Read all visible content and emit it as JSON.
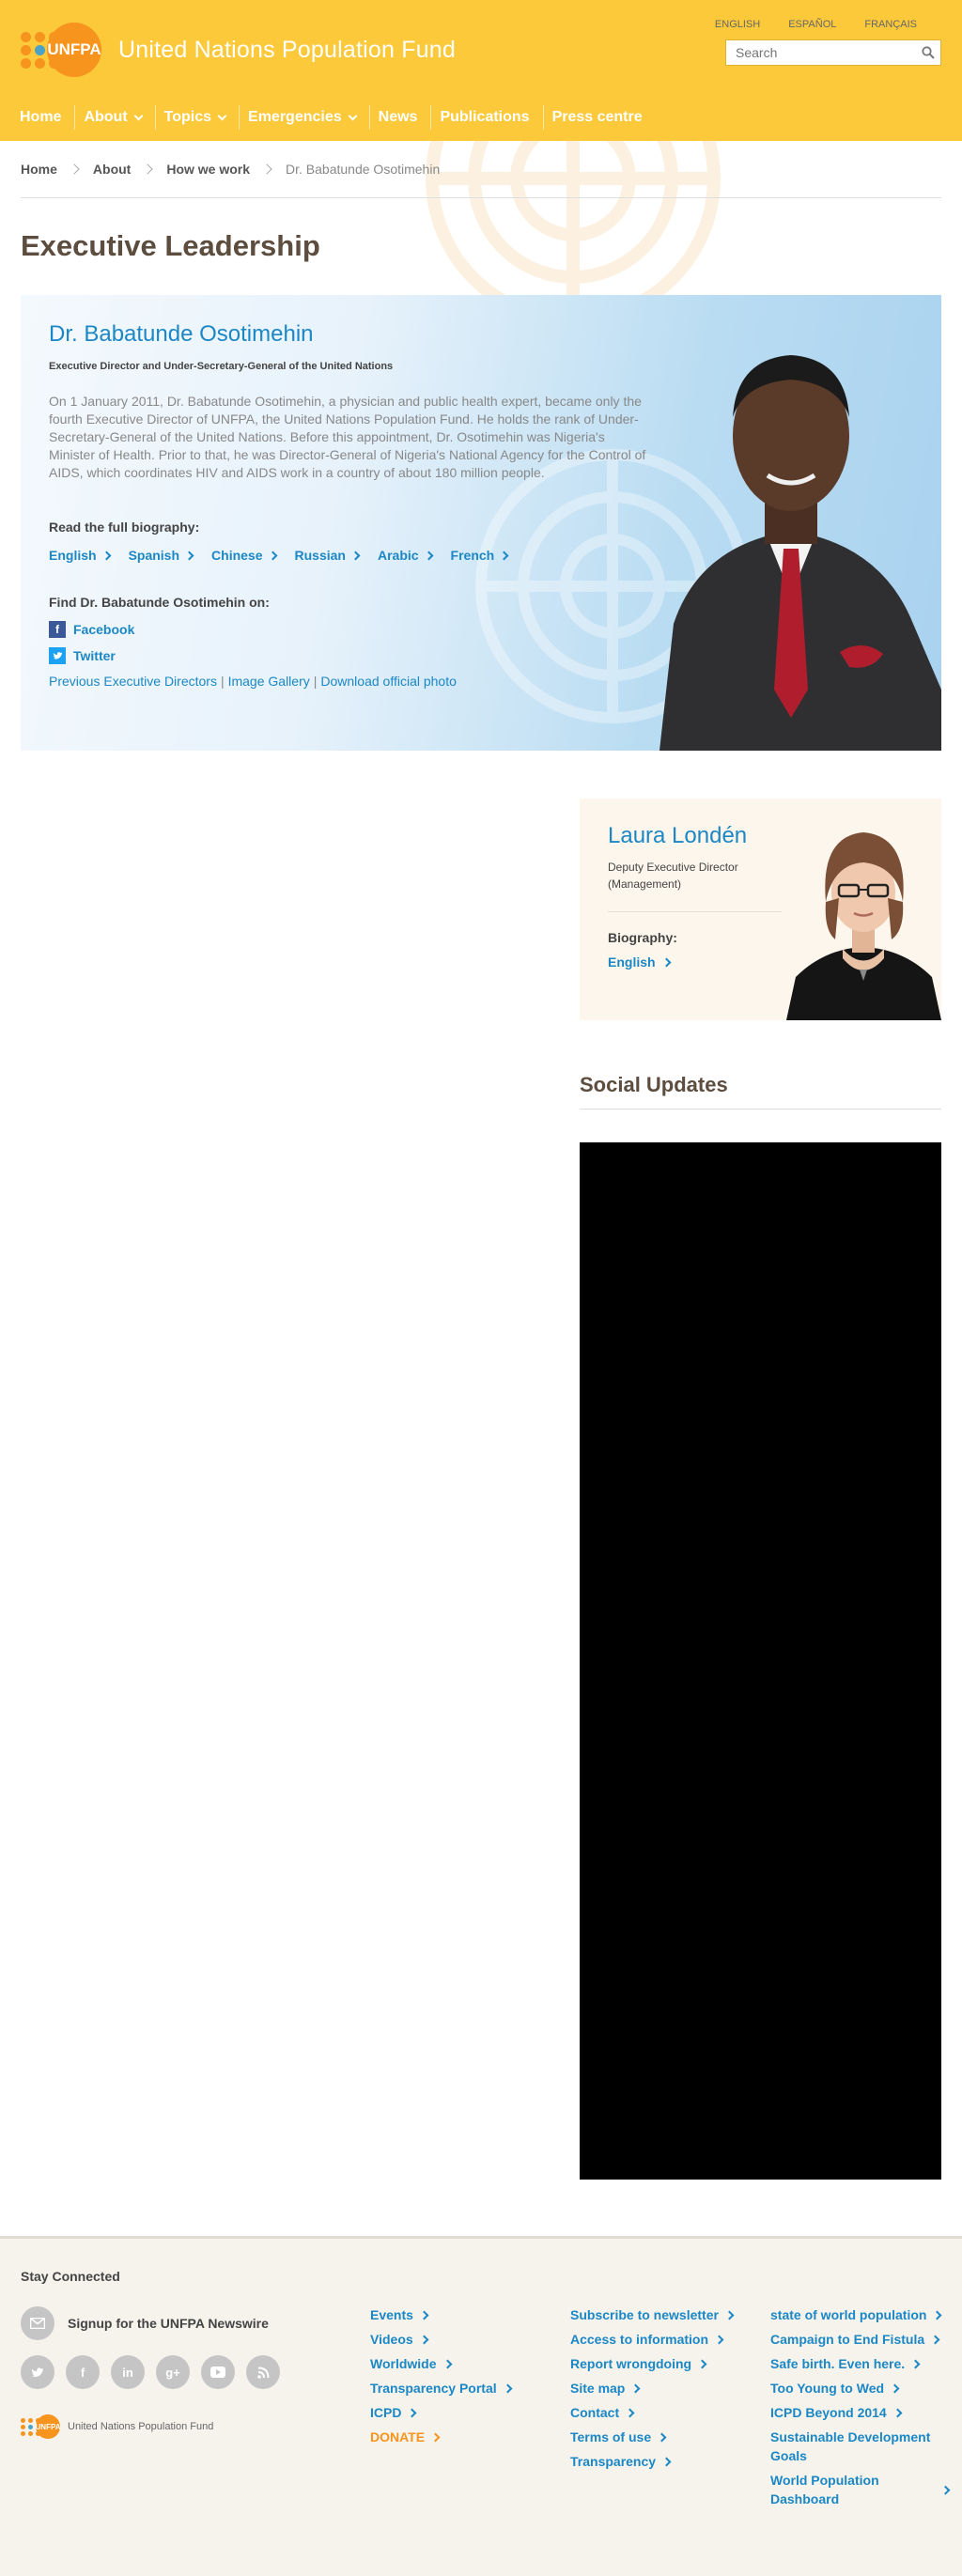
{
  "header": {
    "logo_text": "UNFPA",
    "org_name": "United Nations Population Fund",
    "languages": [
      "ENGLISH",
      "ESPAÑOL",
      "FRANÇAIS"
    ],
    "search_placeholder": "Search",
    "colors": {
      "header_bg": "#fbc93a",
      "accent_orange": "#f7941e",
      "link_blue": "#1b87c5"
    }
  },
  "nav": {
    "items": [
      {
        "label": "Home",
        "dropdown": false
      },
      {
        "label": "About",
        "dropdown": true
      },
      {
        "label": "Topics",
        "dropdown": true
      },
      {
        "label": "Emergencies",
        "dropdown": true
      },
      {
        "label": "News",
        "dropdown": false
      },
      {
        "label": "Publications",
        "dropdown": false
      },
      {
        "label": "Press centre",
        "dropdown": false
      }
    ]
  },
  "breadcrumb": {
    "items": [
      "Home",
      "About",
      "How we work"
    ],
    "current": "Dr. Babatunde Osotimehin"
  },
  "page_title": "Executive Leadership",
  "director": {
    "name": "Dr. Babatunde Osotimehin",
    "role": "Executive Director and Under-Secretary-General of the United Nations",
    "bio": "On 1 January 2011, Dr. Babatunde Osotimehin, a physician and public health expert, became only the fourth Executive Director of UNFPA, the United Nations Population Fund. He holds the rank of Under-Secretary-General of the United Nations. Before this appointment, Dr. Osotimehin was Nigeria's Minister of Health. Prior to that, he was Director-General of Nigeria's National Agency for the Control of AIDS, which coordinates HIV and AIDS work in a country of about 180 million people.",
    "biography_heading": "Read the full biography:",
    "biography_languages": [
      "English",
      "Spanish",
      "Chinese",
      "Russian",
      "Arabic",
      "French"
    ],
    "find_on_heading": "Find Dr. Babatunde Osotimehin on:",
    "social": [
      {
        "label": "Facebook",
        "icon": "facebook-icon"
      },
      {
        "label": "Twitter",
        "icon": "twitter-icon"
      }
    ],
    "extra_links": [
      "Previous Executive Directors",
      "Image Gallery",
      "Download official photo"
    ]
  },
  "deputy": {
    "name": "Laura Londén",
    "role": "Deputy Executive Director (Management)",
    "biography_heading": "Biography:",
    "biography_link": "English"
  },
  "social_updates_title": "Social Updates",
  "footer": {
    "stay_connected": "Stay Connected",
    "newsletter": "Signup for the UNFPA Newswire",
    "social_icons": [
      "twitter-icon",
      "facebook-icon",
      "linkedin-icon",
      "google-plus-icon",
      "youtube-icon",
      "rss-icon"
    ],
    "logo_text": "UNFPA",
    "org_name": "United Nations Population Fund",
    "col1": [
      "Events",
      "Videos",
      "Worldwide",
      "Transparency Portal",
      "ICPD",
      "DONATE"
    ],
    "col2": [
      "Subscribe to newsletter",
      "Access to information",
      "Report wrongdoing",
      "Site map",
      "Contact",
      "Terms of use",
      "Transparency"
    ],
    "col3": [
      "state of world population",
      "Campaign to End Fistula",
      "Safe birth. Even here.",
      "Too Young to Wed",
      "ICPD Beyond 2014",
      "Sustainable Development Goals",
      "World Population Dashboard"
    ]
  }
}
